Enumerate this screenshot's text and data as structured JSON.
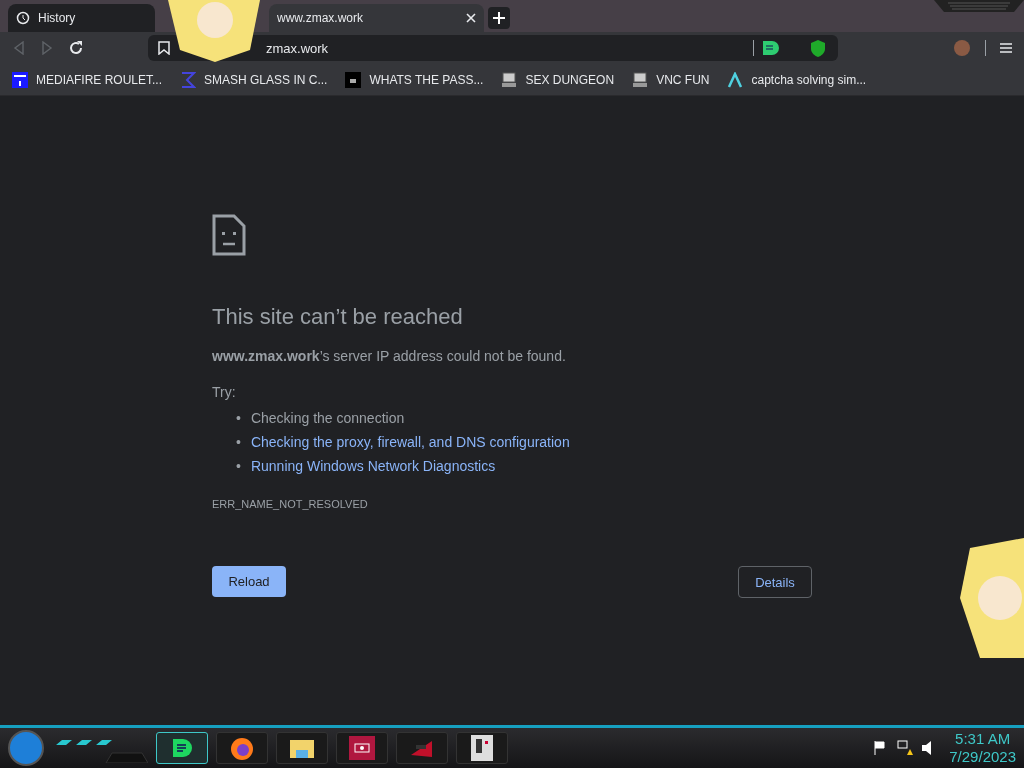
{
  "tabs": [
    {
      "label": "History",
      "kind": "history",
      "selected": false
    },
    {
      "label": "www.zmax.work",
      "kind": "page",
      "selected": true
    }
  ],
  "toolbar": {
    "back_disabled": true,
    "forward_disabled": true,
    "address": "zmax.work"
  },
  "bookmarks": [
    {
      "label": "MEDIAFIRE ROULET...",
      "kind": "mft"
    },
    {
      "label": "SMASH GLASS IN C...",
      "kind": "sigma"
    },
    {
      "label": "WHATS THE PASS...",
      "kind": "dark"
    },
    {
      "label": "SEX DUNGEON",
      "kind": "pc"
    },
    {
      "label": "VNC FUN",
      "kind": "pc"
    },
    {
      "label": "captcha solving sim...",
      "kind": "lambda"
    }
  ],
  "error": {
    "title": "This site can’t be reached",
    "message": "**www.zmax.work**’s server IP address could not be found.",
    "try_label": "Try:",
    "suggestions": [
      {
        "bullet": "•",
        "text": "Checking the connection",
        "kind": "text"
      },
      {
        "bullet": "•",
        "text": "Checking the proxy, firewall, and DNS configuration",
        "kind": "link"
      },
      {
        "bullet": "•",
        "text": "Running Windows Network Diagnostics",
        "kind": "link"
      }
    ],
    "code": "ERR_NAME_NOT_RESOLVED",
    "reload": "Reload",
    "details": "Details"
  },
  "taskbar": {
    "apps": [
      {
        "kind": "chat",
        "selected": true
      },
      {
        "kind": "firefox",
        "selected": false
      },
      {
        "kind": "folder",
        "selected": false
      },
      {
        "kind": "screen",
        "selected": false
      },
      {
        "kind": "game",
        "selected": false
      },
      {
        "kind": "pixel",
        "selected": false
      }
    ],
    "time": "5:31 AM",
    "date": "7/29/2023"
  }
}
